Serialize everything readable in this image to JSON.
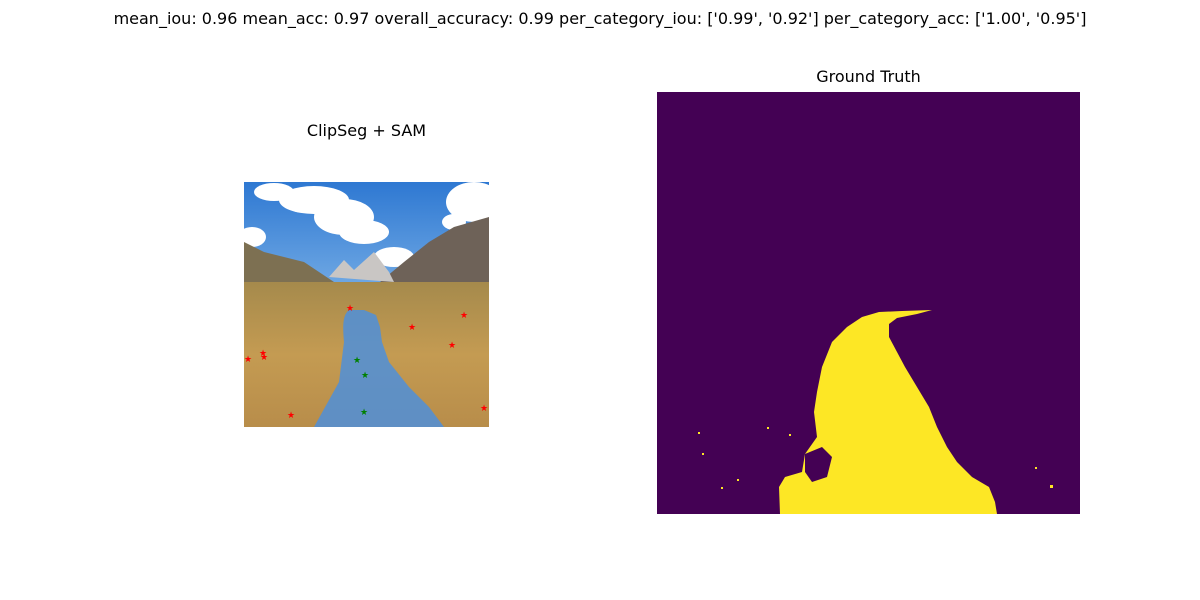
{
  "figure": {
    "suptitle": "mean_iou: 0.96  mean_acc: 0.97  overall_accuracy: 0.99  per_category_iou: ['0.99', '0.92']  per_category_acc: ['1.00', '0.95']",
    "panels": [
      {
        "title": "ClipSeg + SAM"
      },
      {
        "title": "Ground Truth"
      }
    ]
  },
  "metrics": {
    "mean_iou": 0.96,
    "mean_acc": 0.97,
    "overall_accuracy": 0.99,
    "per_category_iou": [
      0.99,
      0.92
    ],
    "per_category_acc": [
      1.0,
      0.95
    ]
  },
  "colors": {
    "sky": "#3f86d6",
    "cloud": "#ffffff",
    "mountain": "#6e6258",
    "grass": "#b7924c",
    "mask_overlay": "#4f8fd9",
    "negative_point": "#ff0000",
    "positive_point": "#008000",
    "gt_background": "#440154",
    "gt_foreground": "#fde725"
  },
  "icons": {
    "negative_point": "red-star-icon",
    "positive_point": "green-star-icon"
  }
}
